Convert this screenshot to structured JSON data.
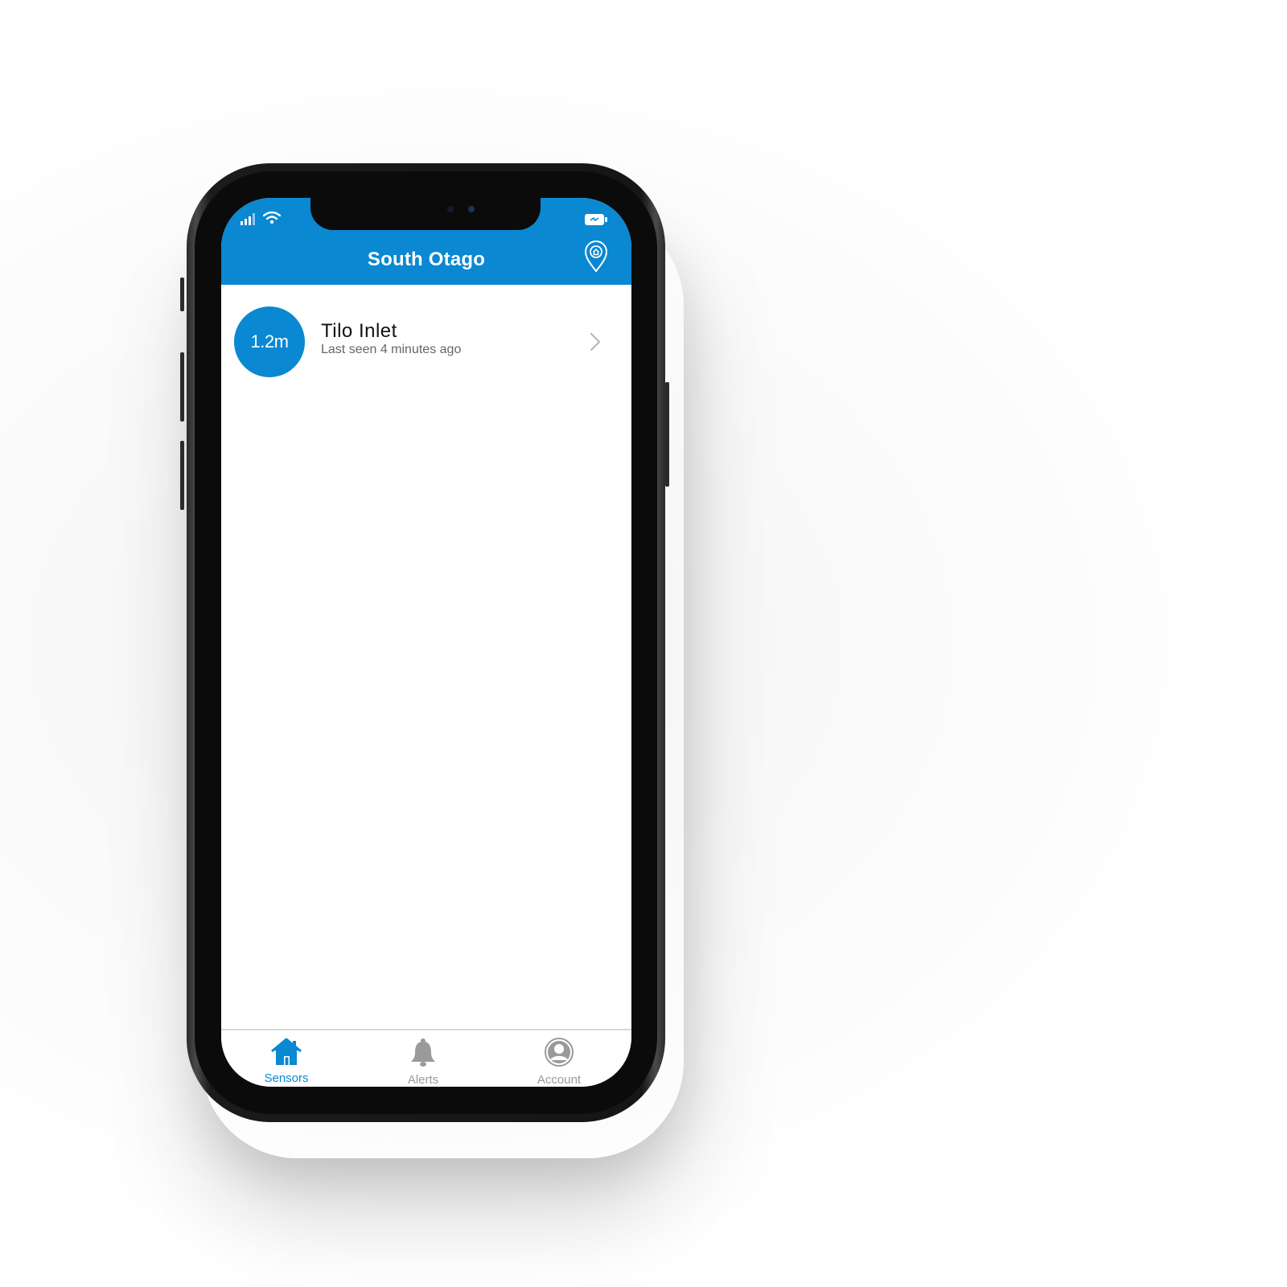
{
  "header": {
    "title": "South Otago",
    "location_icon": "location-home-pin-icon"
  },
  "sensors": [
    {
      "level": "1.2m",
      "name": "Tilo Inlet",
      "last_seen": "Last seen 4 minutes ago"
    }
  ],
  "tabs": [
    {
      "label": "Sensors",
      "icon": "home-icon",
      "active": true
    },
    {
      "label": "Alerts",
      "icon": "bell-icon",
      "active": false
    },
    {
      "label": "Account",
      "icon": "user-icon",
      "active": false
    }
  ],
  "colors": {
    "accent": "#0a88d2",
    "inactive_tab": "#9a9a9a",
    "text_primary": "#111111",
    "text_secondary": "#666666"
  }
}
